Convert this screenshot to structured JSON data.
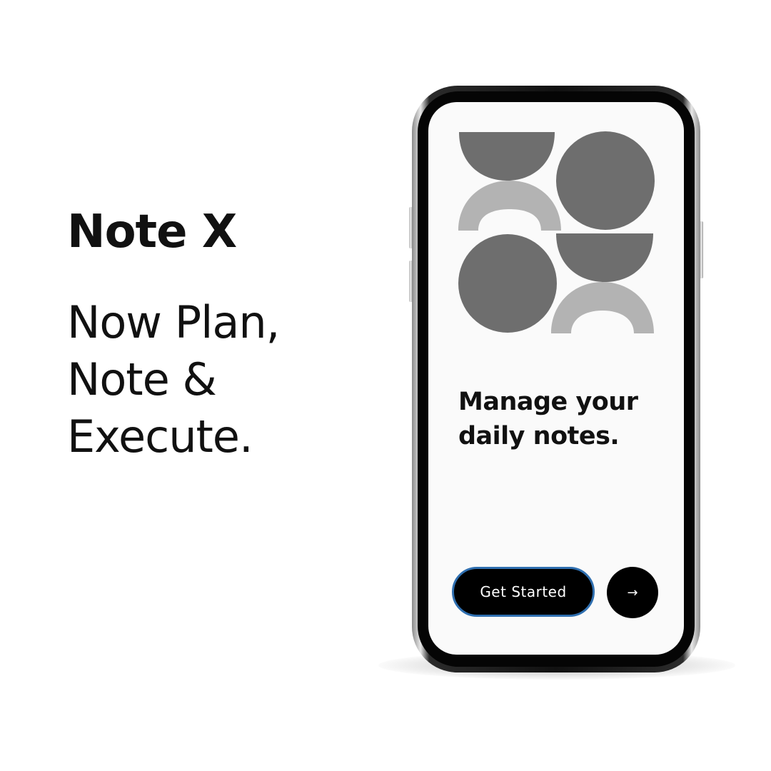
{
  "promo": {
    "brand": "Note X",
    "tagline_lines": [
      "Now Plan,",
      "Note &",
      "Execute."
    ]
  },
  "app_screen": {
    "illustration": "abstract-shapes-illustration",
    "headline_lines": [
      "Manage your",
      "daily notes."
    ],
    "get_started_label": "Get Started",
    "next_icon": "→"
  },
  "colors": {
    "text": "#111111",
    "button": "#000000",
    "button_border": "#2f6fb0",
    "shape_dark": "#6e6e6e",
    "shape_light": "#b3b3b3"
  }
}
